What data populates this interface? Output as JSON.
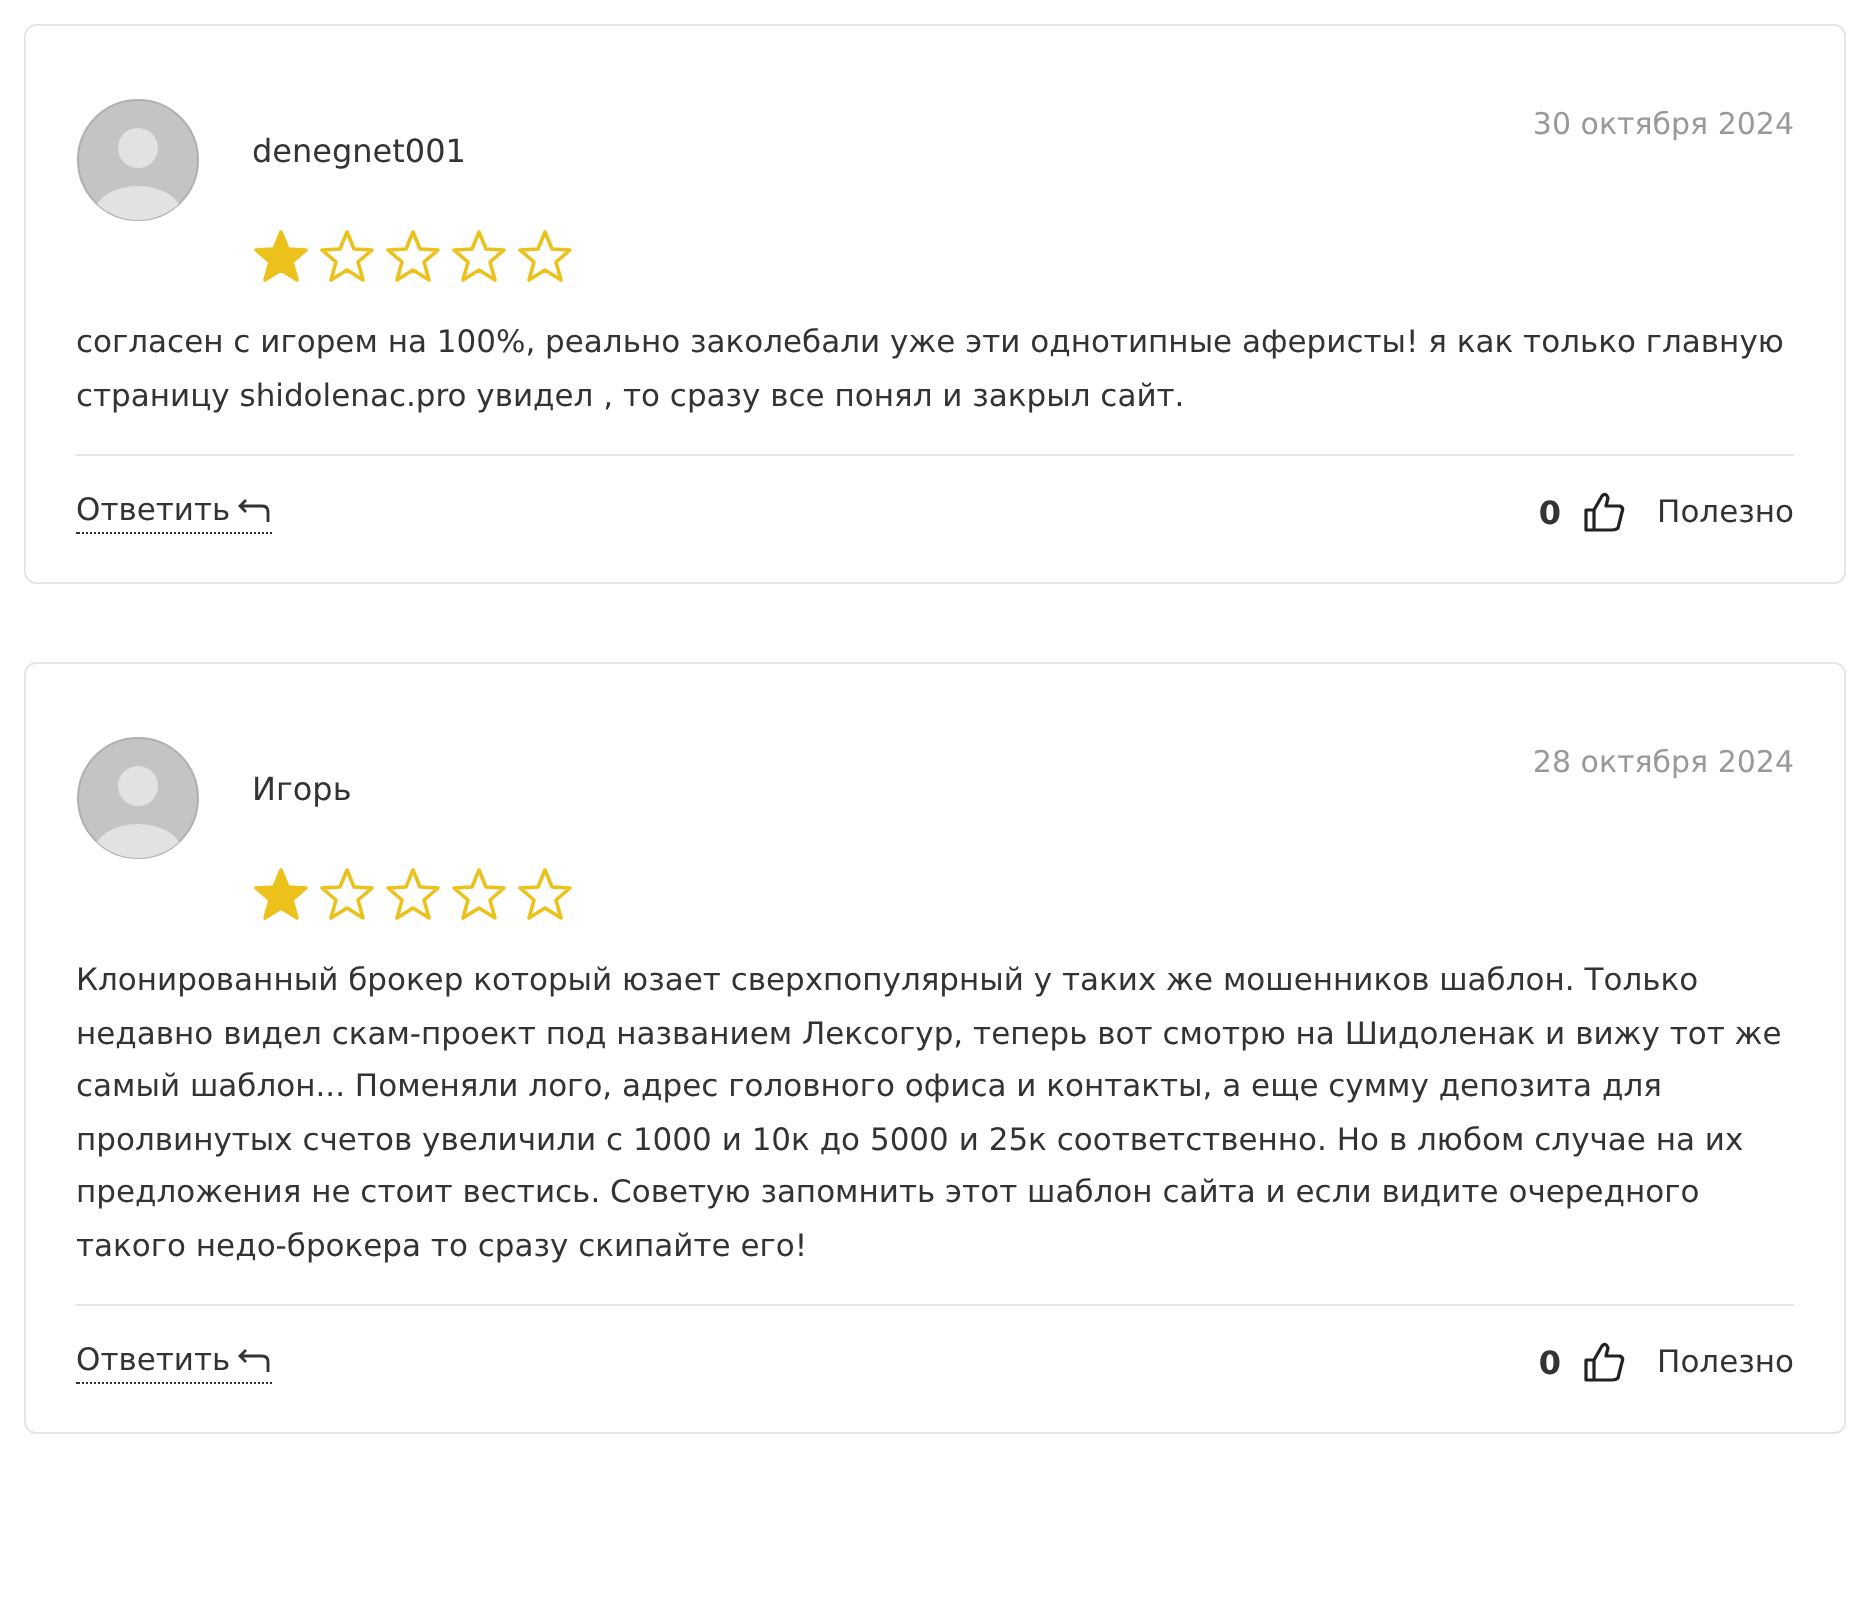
{
  "reviews": [
    {
      "author": "denegnet001",
      "date": "30 октября 2024",
      "stars": 1,
      "text": "согласен с игорем на 100%, реально заколебали уже эти однотипные аферисты! я как только главную страницу shidolenac.pro увидел , то сразу все понял и закрыл сайт.",
      "reply": "Ответить",
      "likes": "0",
      "helpful": "Полезно"
    },
    {
      "author": "Игорь",
      "date": "28 октября 2024",
      "stars": 1,
      "text": "Клонированный брокер который юзает сверхпопулярный у таких же мошенников шаблон. Только недавно видел скам-проект под названием Лексогур, теперь вот смотрю на Шидоленак и вижу тот же самый шаблон... Поменяли лого, адрес головного офиса и контакты, а еще сумму депозита для пролвинутых счетов увеличили с 1000 и 10к до 5000 и 25к соответственно. Но в любом случае на их предложения не стоит вестись. Советую запомнить этот шаблон сайта и если видите очередного такого недо-брокера то сразу скипайте его!",
      "reply": "Ответить",
      "likes": "0",
      "helpful": "Полезно"
    }
  ]
}
